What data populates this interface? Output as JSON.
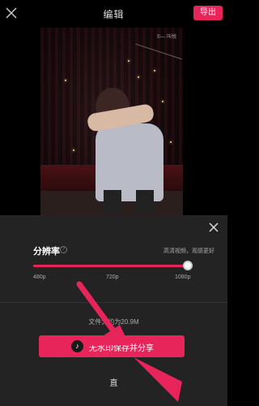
{
  "header": {
    "title": "编辑",
    "export_label": "导出"
  },
  "video": {
    "watermark": "©—  叫悦"
  },
  "panel": {
    "resolution_label": "分辨率",
    "info_symbol": "?",
    "resolution_hint": "高清视频，观感更好",
    "ticks": [
      "480p",
      "720p",
      "1080p"
    ],
    "selected_resolution": "1080p",
    "slider_level": 1.0,
    "file_size_text": "文件大约为20.9M",
    "share_button_label": "无水印保存并分享",
    "direct_label": "直"
  },
  "colors": {
    "accent": "#e8255a",
    "panel_bg": "#232323",
    "arrow": "#e8255a"
  }
}
